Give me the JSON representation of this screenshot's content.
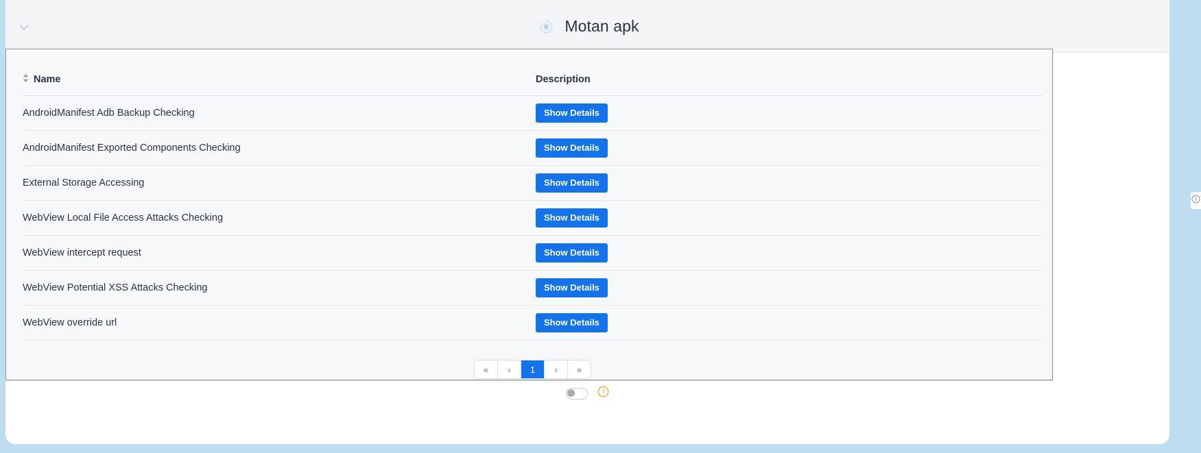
{
  "header": {
    "title": "Motan apk",
    "app_icon": "radar-scan-icon",
    "collapse_icon": "chevron-down-icon"
  },
  "table": {
    "columns": [
      {
        "key": "name",
        "label": "Name",
        "sortable": true,
        "sort_icon": "sort-updown-icon"
      },
      {
        "key": "description",
        "label": "Description",
        "sortable": false
      }
    ],
    "rows": [
      {
        "name": "AndroidManifest Adb Backup Checking",
        "action_label": "Show Details"
      },
      {
        "name": "AndroidManifest Exported Components Checking",
        "action_label": "Show Details"
      },
      {
        "name": "External Storage Accessing",
        "action_label": "Show Details"
      },
      {
        "name": "WebView Local File Access Attacks Checking",
        "action_label": "Show Details"
      },
      {
        "name": "WebView intercept request",
        "action_label": "Show Details"
      },
      {
        "name": "WebView Potential XSS Attacks Checking",
        "action_label": "Show Details"
      },
      {
        "name": "WebView override url",
        "action_label": "Show Details"
      }
    ]
  },
  "pagination": {
    "first_label": "«",
    "prev_label": "‹",
    "pages": [
      "1"
    ],
    "current_page": "1",
    "next_label": "›",
    "last_label": "»"
  },
  "footer": {
    "toggle_state": "off",
    "toggle_name": "settings-toggle",
    "help_icon": "question-circle-icon"
  },
  "right_edge": {
    "info_icon": "info-circle-icon"
  },
  "colors": {
    "accent_blue": "#1273ec",
    "page_backdrop": "#bfddf0",
    "header_bg": "#f4f5f6",
    "panel_bg": "#f7f8fa",
    "text_primary": "#2b3340",
    "help_orange": "#f0a63c"
  }
}
